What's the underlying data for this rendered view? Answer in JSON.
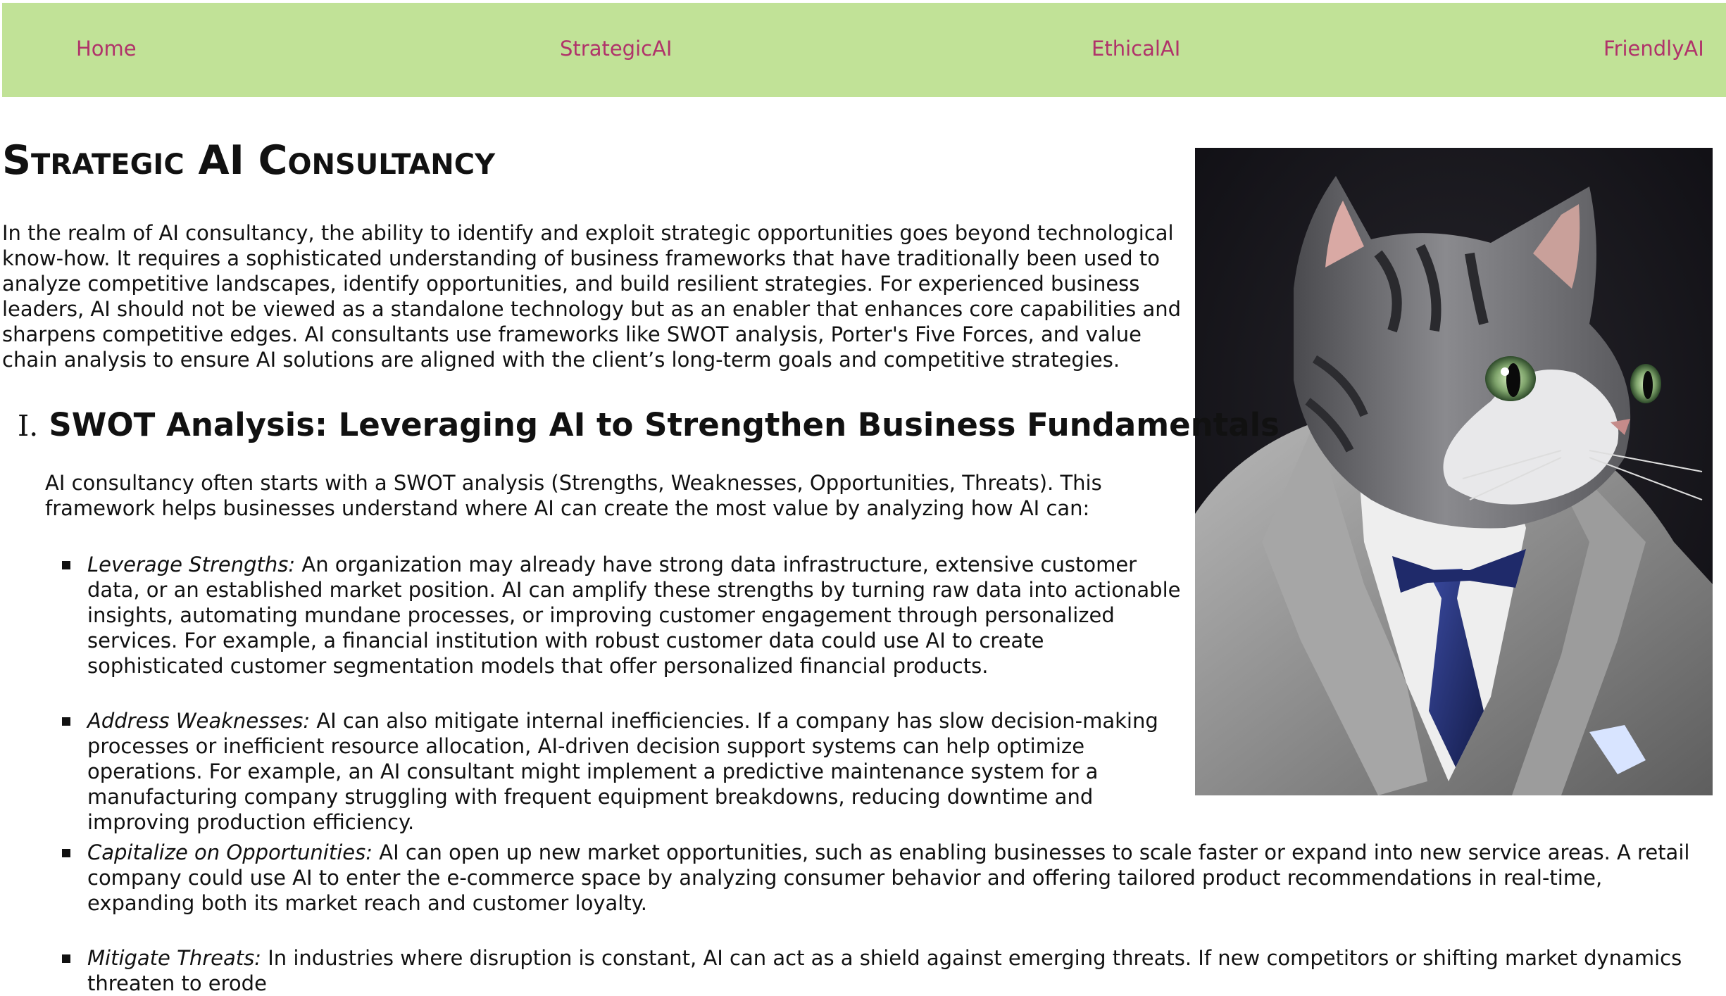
{
  "nav": {
    "items": [
      {
        "label": "Home"
      },
      {
        "label": "StrategicAI"
      },
      {
        "label": "EthicalAI"
      },
      {
        "label": "FriendlyAI"
      }
    ],
    "background": "#c1e297",
    "link_color": "#b0336a"
  },
  "main": {
    "title": "Strategic AI Consultancy",
    "intro": "In the realm of AI consultancy, the ability to identify and exploit strategic opportunities goes beyond technological know-how. It requires a sophisticated understanding of business frameworks that have traditionally been used to analyze competitive landscapes, identify opportunities, and build resilient strategies. For experienced business leaders, AI should not be viewed as a standalone technology but as an enabler that enhances core capabilities and sharpens competitive edges. AI consultants use frameworks like SWOT analysis, Porter's Five Forces, and value chain analysis to ensure AI solutions are aligned with the client’s long-term goals and competitive strategies.",
    "section": {
      "number": "I.",
      "title": "SWOT Analysis: Leveraging AI to Strengthen Business Fundamentals",
      "intro": "AI consultancy often starts with a SWOT analysis (Strengths, Weaknesses, Opportunities, Threats). This framework helps businesses understand where AI can create the most value by analyzing how AI can:",
      "items": [
        {
          "lead": "Leverage Strengths:",
          "text": " An organization may already have strong data infrastructure, extensive customer data, or an established market position. AI can amplify these strengths by turning raw data into actionable insights, automating mundane processes, or improving customer engagement through personalized services. For example, a financial institution with robust customer data could use AI to create sophisticated customer segmentation models that offer personalized financial products."
        },
        {
          "lead": "Address Weaknesses:",
          "text": " AI can also mitigate internal inefficiencies. If a company has slow decision-making processes or inefficient resource allocation, AI-driven decision support systems can help optimize operations. For example, an AI consultant might implement a predictive maintenance system for a manufacturing company struggling with frequent equipment breakdowns, reducing downtime and improving production efficiency."
        },
        {
          "lead": "Capitalize on Opportunities:",
          "text": " AI can open up new market opportunities, such as enabling businesses to scale faster or expand into new service areas. A retail company could use AI to enter the e-commerce space by analyzing consumer behavior and offering tailored product recommendations in real-time, expanding both its market reach and customer loyalty."
        },
        {
          "lead": "Mitigate Threats:",
          "text": " In industries where disruption is constant, AI can act as a shield against emerging threats. If new competitors or shifting market dynamics threaten to erode"
        }
      ]
    }
  },
  "hero_image": {
    "icon": "cat-in-suit-portrait",
    "background": "#131217"
  }
}
